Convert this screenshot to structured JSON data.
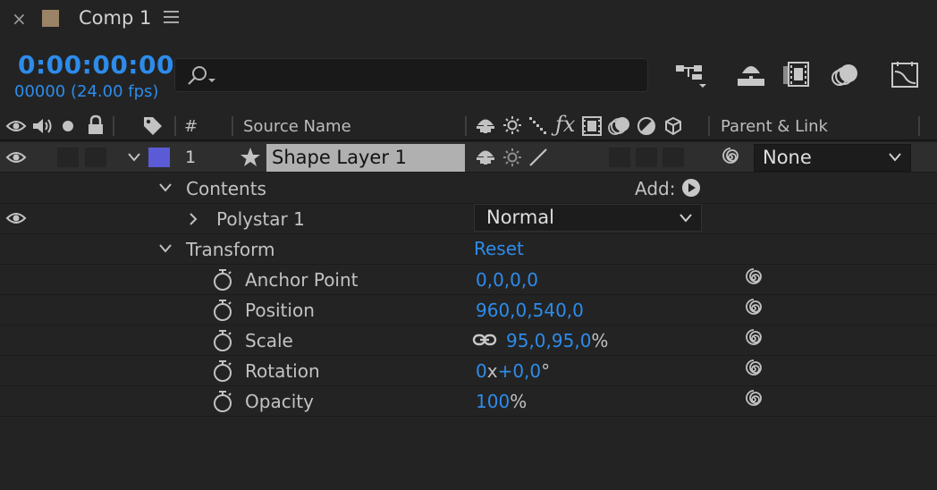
{
  "tab": {
    "close_glyph": "×",
    "title": "Comp 1",
    "swatch_color": "#9a8366",
    "menu_icon": "hamburger-menu-icon"
  },
  "header": {
    "timecode": "0:00:00:00",
    "fps": "00000 (24.00 fps)",
    "search_placeholder": ""
  },
  "header_icons": [
    "composition-mini-flowchart-icon",
    "draft-3d-icon",
    "frame-blending-icon",
    "motion-blur-icon",
    "graph-editor-icon"
  ],
  "columns": {
    "hash": "#",
    "source_name": "Source Name",
    "parent_link": "Parent & Link"
  },
  "layer": {
    "number": "1",
    "name": "Shape Layer 1",
    "label_color": "#5b5bd6",
    "parent": "None"
  },
  "rows": {
    "contents": "Contents",
    "add": "Add:",
    "polystar": "Polystar 1",
    "blend_mode": "Normal",
    "transform": "Transform",
    "reset": "Reset"
  },
  "properties": [
    {
      "name": "Anchor Point",
      "value": "0,0,0,0",
      "suffix": ""
    },
    {
      "name": "Position",
      "value": "960,0,540,0",
      "suffix": ""
    },
    {
      "name": "Scale",
      "value": "95,0,95,0",
      "suffix": "%"
    },
    {
      "name": "Rotation",
      "value_a": "0",
      "mid": "x",
      "value_b": "+0,0",
      "suffix": "°"
    },
    {
      "name": "Opacity",
      "value": "100",
      "suffix": "%"
    }
  ],
  "accent_color": "#2d8ceb"
}
